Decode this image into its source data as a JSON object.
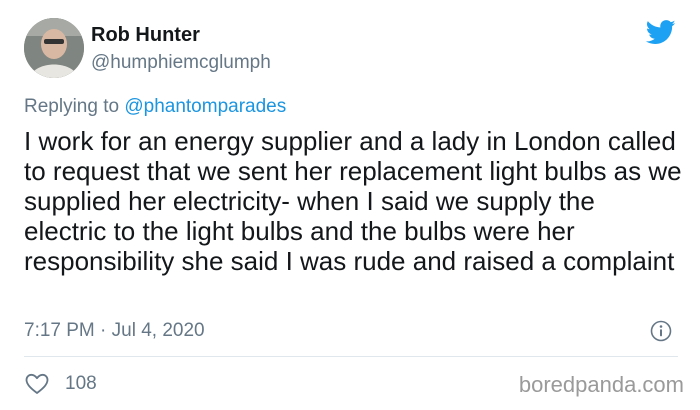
{
  "tweet": {
    "display_name": "Rob Hunter",
    "handle": "@humphiemcglumph",
    "replying_prefix": "Replying to ",
    "replying_to": "@phantomparades",
    "text": "I work for an energy supplier and a lady in London called to request that we sent her replacement light bulbs as we supplied her electricity- when I said we supply the electric to the light bulbs and the bulbs were her responsibility she said I was rude and raised a complaint",
    "timestamp": "7:17 PM · Jul 4, 2020",
    "likes": "108"
  },
  "watermark": "boredpanda.com",
  "icons": {
    "brand": "twitter-bird-icon",
    "info": "info-icon",
    "like": "heart-icon"
  },
  "colors": {
    "twitter_blue": "#1da1f2",
    "mention": "#1b95e0",
    "muted_text": "#657786"
  }
}
